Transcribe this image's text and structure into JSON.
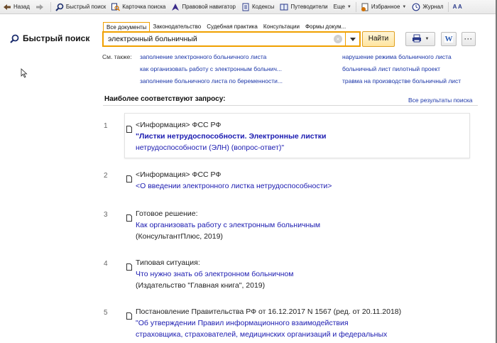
{
  "toolbar": {
    "back": "Назад",
    "quick_search": "Быстрый поиск",
    "search_card": "Карточка поиска",
    "legal_navigator": "Правовой навигатор",
    "codes": "Кодексы",
    "guides": "Путеводители",
    "more": "Еще",
    "favorites": "Избранное",
    "journal": "Журнал",
    "font_size": "A A",
    "favorites_badge": "6"
  },
  "page": {
    "title": "Быстрый поиск"
  },
  "search": {
    "tabs": [
      "Все документы",
      "Законодательство",
      "Судебная практика",
      "Консультации",
      "Формы докум..."
    ],
    "query": "электронный больничный",
    "find_label": "Найти",
    "clear_symbol": "×"
  },
  "see_also": {
    "label": "См. также:",
    "links": [
      "заполнение электронного больничного листа",
      "как организовать работу с электронным больнич...",
      "заполнение больничного листа по беременности...",
      "нарушение режима больничного листа",
      "больничный лист пилотный проект",
      "травма на производстве больничный лист"
    ]
  },
  "results": {
    "header": "Наиболее соответствуют запросу:",
    "all_results": "Все результаты поиска",
    "items": [
      {
        "num": "1",
        "source": "<Информация> ФСС РФ",
        "title_line1": "\"Листки нетрудоспособности. Электронные листки",
        "title_line2": "нетрудоспособности (ЭЛН) (вопрос-ответ)\""
      },
      {
        "num": "2",
        "source": "<Информация> ФСС РФ",
        "title_line1": "<О введении электронного листка нетрудоспособности>"
      },
      {
        "num": "3",
        "source": "Готовое решение:",
        "title_line1": "Как организовать работу с электронным больничным",
        "extra": "(КонсультантПлюс, 2019)"
      },
      {
        "num": "4",
        "source": "Типовая ситуация:",
        "title_line1": "Что нужно знать об электронном больничном",
        "extra": "(Издательство \"Главная книга\", 2019)"
      },
      {
        "num": "5",
        "source": "Постановление Правительства РФ от 16.12.2017 N 1567 (ред. от 20.11.2018)",
        "title_line1": "\"Об утверждении Правил информационного взаимодействия",
        "title_line2": "страховщика, страхователей, медицинских организаций и федеральных"
      }
    ]
  }
}
